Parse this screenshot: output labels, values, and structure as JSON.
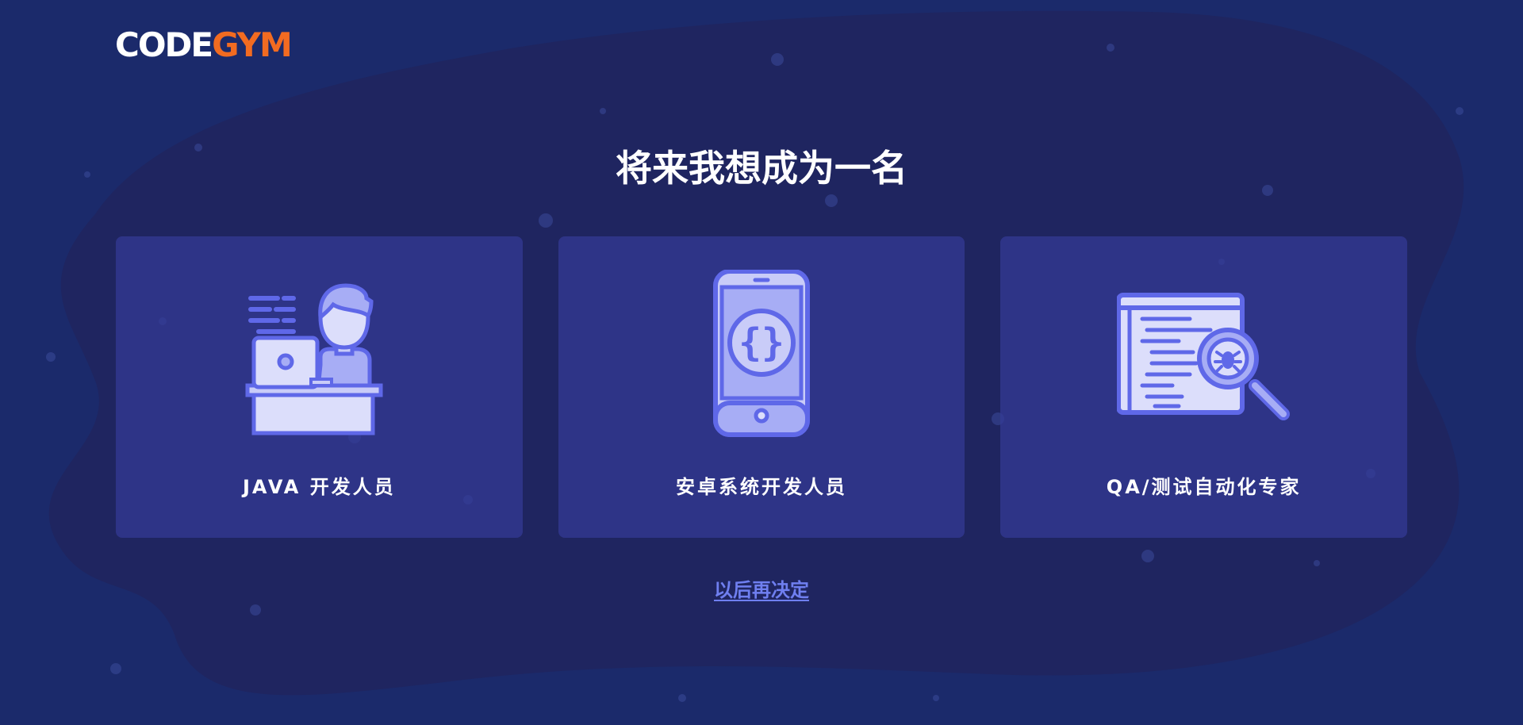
{
  "brand": {
    "logo_part1": "CODE",
    "logo_part2": "GYM",
    "logo_colors": {
      "code": "#ffffff",
      "gym": "#f26b21"
    }
  },
  "heading": "将来我想成为一名",
  "cards": [
    {
      "label": "JAVA 开发人员",
      "icon": "java-developer-icon"
    },
    {
      "label": "安卓系统开发人员",
      "icon": "android-phone-icon"
    },
    {
      "label": "QA/测试自动化专家",
      "icon": "qa-testing-icon"
    }
  ],
  "decide_later": "以后再决定",
  "colors": {
    "background": "#1b2a6b",
    "card": "#343a96",
    "accent": "#6f7ff0",
    "icon_fill": "#a7adf5",
    "icon_stroke": "#5f68e8"
  }
}
